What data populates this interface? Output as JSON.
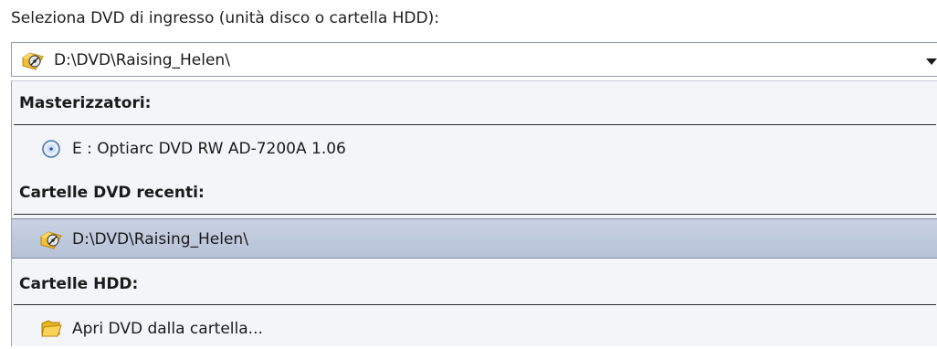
{
  "prompt_label": "Seleziona DVD di ingresso (unità disco o cartella HDD):",
  "combo": {
    "value": "D:\\DVD\\Raising_Helen\\",
    "icon": "dvd-folder-icon"
  },
  "dropdown": {
    "groups": [
      {
        "header": "Masterizzatori:",
        "items": [
          {
            "label": "E : Optiarc  DVD RW AD-7200A  1.06",
            "icon": "optical-drive-icon"
          }
        ]
      },
      {
        "header": "Cartelle DVD recenti:",
        "items": [
          {
            "label": "D:\\DVD\\Raising_Helen\\",
            "icon": "dvd-folder-icon",
            "selected": true
          }
        ]
      },
      {
        "header": "Cartelle HDD:",
        "items": [
          {
            "label": "Apri DVD dalla cartella...",
            "icon": "open-folder-icon"
          }
        ]
      }
    ]
  }
}
